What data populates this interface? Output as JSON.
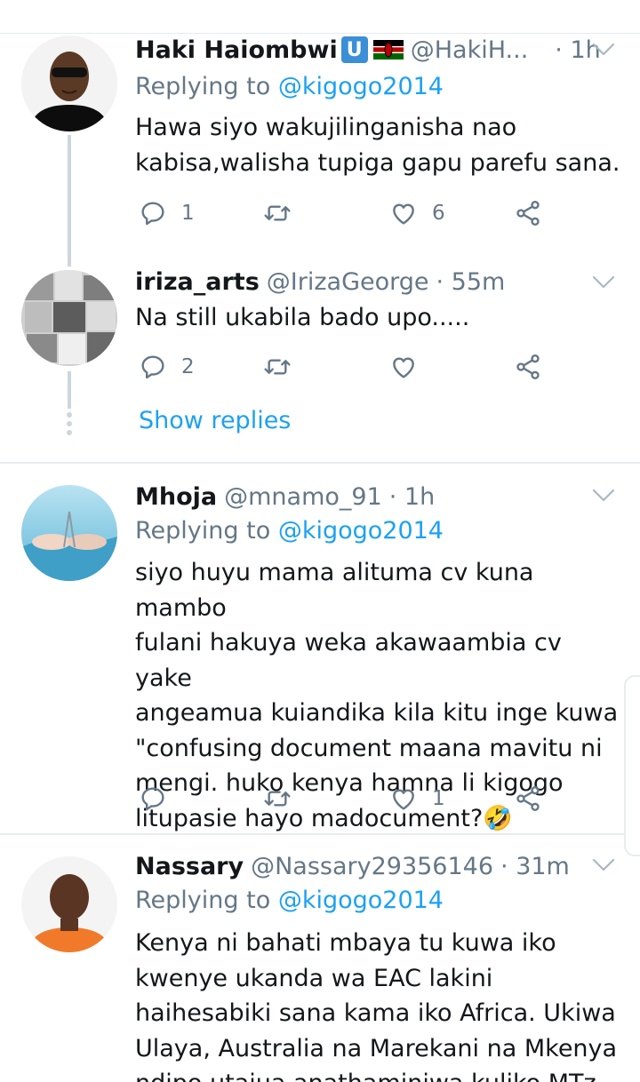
{
  "tweets": [
    {
      "name": "Haki Haiombwi",
      "badge": "U",
      "handle": "@HakiH...",
      "time": "· 1h",
      "replying_label": "Replying to",
      "replying_to": "@kigogo2014",
      "text": "Hawa siyo wakujilinganisha nao\nkabisa,walisha tupiga gapu parefu sana.",
      "replies": "1",
      "retweets": "",
      "likes": "6"
    },
    {
      "name": "iriza_arts",
      "handle": "@IrizaGeorge",
      "time": "· 55m",
      "text": "Na still ukabila bado upo.....",
      "replies": "2",
      "retweets": "",
      "likes": "",
      "show_replies": "Show replies"
    },
    {
      "name": "Mhoja",
      "handle": "@mnamo_91",
      "time": "· 1h",
      "replying_label": "Replying to",
      "replying_to": "@kigogo2014",
      "text": "siyo huyu mama alituma cv kuna mambo\nfulani hakuya weka akawaambia cv yake\nangeamua kuiandika kila kitu inge kuwa\n\"confusing document maana mavitu ni\nmengi. huko kenya hamna li kigogo\nlitupasie hayo madocument?",
      "emoji": "🤣",
      "replies": "",
      "retweets": "",
      "likes": "1"
    },
    {
      "name": "Nassary",
      "handle": "@Nassary29356146",
      "time": "· 31m",
      "replying_label": "Replying to",
      "replying_to": "@kigogo2014",
      "text": "Kenya ni bahati mbaya tu kuwa iko\nkwenye ukanda wa EAC lakini\nhaihesabiki sana kama iko Africa. Ukiwa\nUlaya, Australia na Marekani na Mkenya\nndipo utajua anathaminiwa kuliko MTz"
    }
  ],
  "colors": {
    "text": "#14171a",
    "secondary": "#657786",
    "link": "#1da1f2",
    "divider": "#e6ecf0"
  },
  "icons": [
    "reply-icon",
    "retweet-icon",
    "like-icon",
    "share-icon",
    "chevron-down-icon",
    "verified-u-badge",
    "kenya-flag-icon"
  ]
}
